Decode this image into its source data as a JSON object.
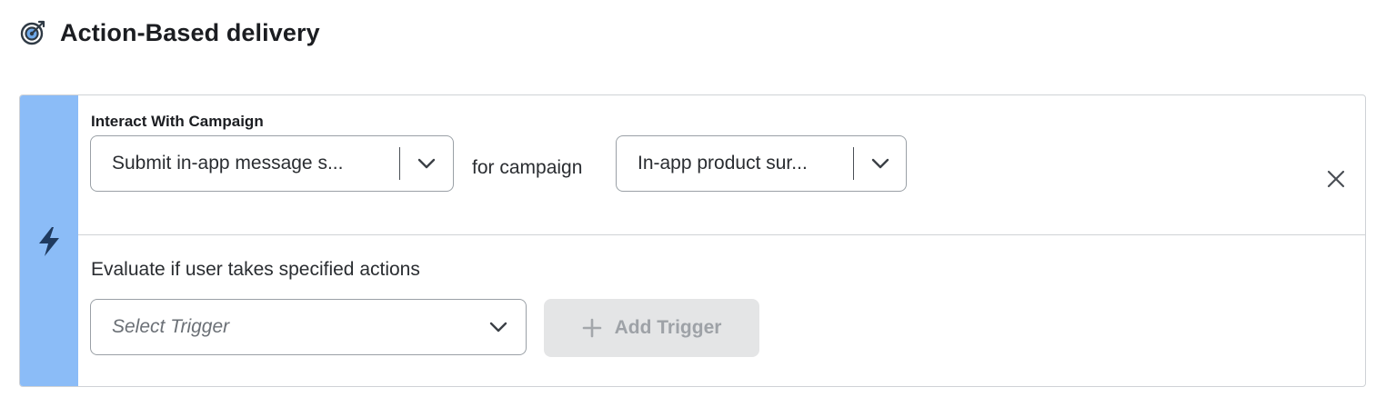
{
  "header": {
    "icon": "target-icon",
    "title": "Action-Based delivery"
  },
  "rail": {
    "icon": "lightning-bolt-icon",
    "color": "#8bbcf7"
  },
  "interact": {
    "label": "Interact With Campaign",
    "action_select": {
      "value": "Submit in-app message s..."
    },
    "connector": "for campaign",
    "campaign_select": {
      "value": "In-app product sur..."
    }
  },
  "evaluate": {
    "text": "Evaluate if user takes specified actions",
    "trigger_select": {
      "placeholder": "Select Trigger"
    },
    "add_trigger": {
      "label": "Add Trigger",
      "disabled": true
    }
  }
}
